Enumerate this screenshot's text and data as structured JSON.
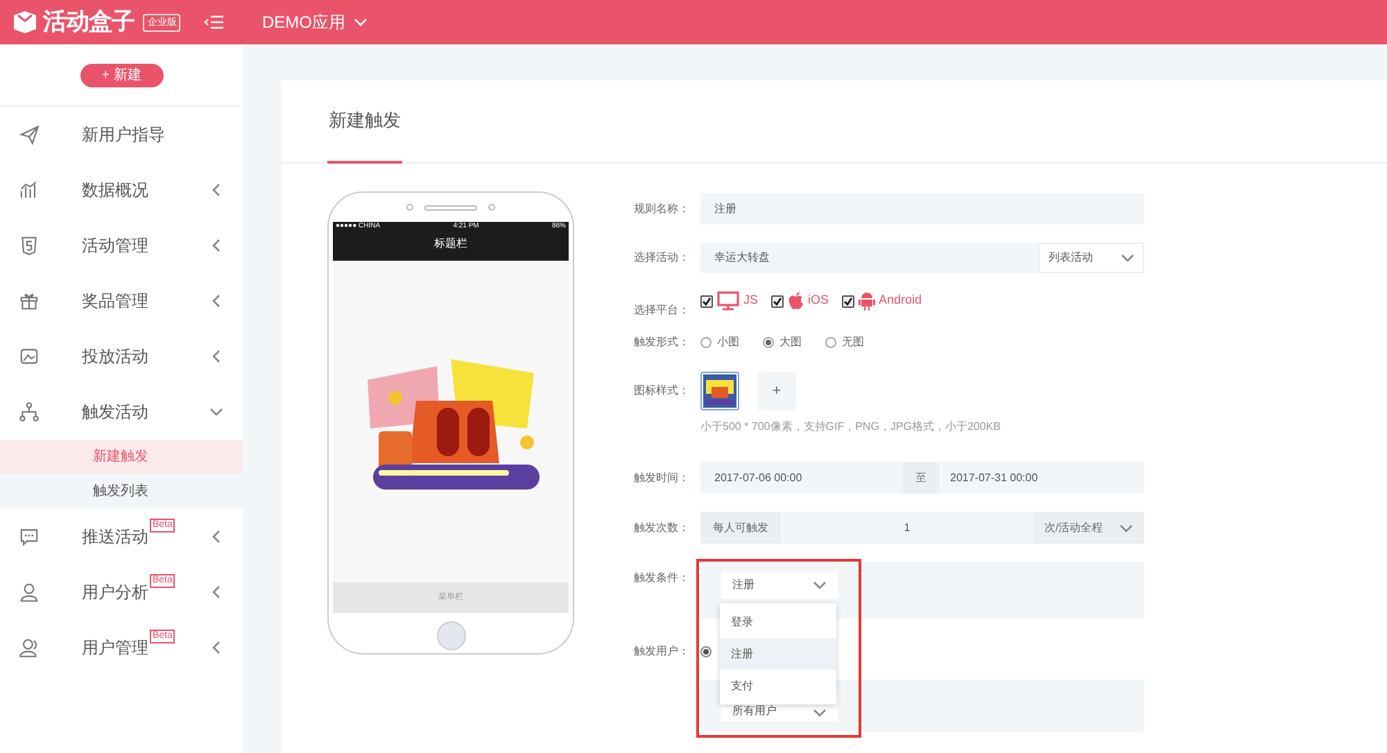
{
  "header": {
    "logo_text": "活动盒子",
    "edition_badge": "企业版",
    "app_selector": "DEMO应用"
  },
  "sidebar": {
    "new_button": "+ 新建",
    "items": [
      {
        "label": "新用户指导"
      },
      {
        "label": "数据概况",
        "expanded": false
      },
      {
        "label": "活动管理",
        "expanded": false
      },
      {
        "label": "奖品管理",
        "expanded": false
      },
      {
        "label": "投放活动",
        "expanded": false
      },
      {
        "label": "触发活动",
        "expanded": true,
        "children": [
          {
            "label": "新建触发",
            "selected": true
          },
          {
            "label": "触发列表",
            "selected": false
          }
        ]
      },
      {
        "label": "推送活动",
        "expanded": false,
        "beta": "Beta"
      },
      {
        "label": "用户分析",
        "expanded": false,
        "beta": "Beta"
      },
      {
        "label": "用户管理",
        "expanded": false,
        "beta": "Beta"
      }
    ]
  },
  "page": {
    "tab": "新建触发"
  },
  "phone": {
    "carrier": "●●●●● CHINA",
    "time": "4:21 PM",
    "battery": "86%",
    "title_bar": "标题栏",
    "menu_bar": "菜单栏"
  },
  "form": {
    "rule_name": {
      "label": "规则名称：",
      "value": "注册"
    },
    "activity": {
      "label": "选择活动：",
      "value": "幸运大转盘",
      "type": "列表活动"
    },
    "platform": {
      "label": "选择平台：",
      "options": [
        {
          "label": "JS",
          "checked": true
        },
        {
          "label": "iOS",
          "checked": true
        },
        {
          "label": "Android",
          "checked": true
        }
      ]
    },
    "style": {
      "label": "触发形式：",
      "options": [
        {
          "label": "小图",
          "selected": false
        },
        {
          "label": "大图",
          "selected": true
        },
        {
          "label": "无图",
          "selected": false
        }
      ]
    },
    "icon_style": {
      "label": "图标样式：",
      "add": "+",
      "hint": "小于500 * 700像素，支持GIF，PNG，JPG格式，小于200KB"
    },
    "time": {
      "label": "触发时间：",
      "start": "2017-07-06 00:00",
      "sep": "至",
      "end": "2017-07-31 00:00"
    },
    "count": {
      "label": "触发次数：",
      "prefix": "每人可触发",
      "value": "1",
      "unit": "次/活动全程"
    },
    "condition": {
      "label": "触发条件：",
      "value": "注册",
      "open": true,
      "options": [
        {
          "label": "登录",
          "selected": false
        },
        {
          "label": "注册",
          "selected": true
        },
        {
          "label": "支付",
          "selected": false
        }
      ]
    },
    "users": {
      "label": "触发用户：",
      "radio_selected": true,
      "value": "所有用户"
    }
  }
}
